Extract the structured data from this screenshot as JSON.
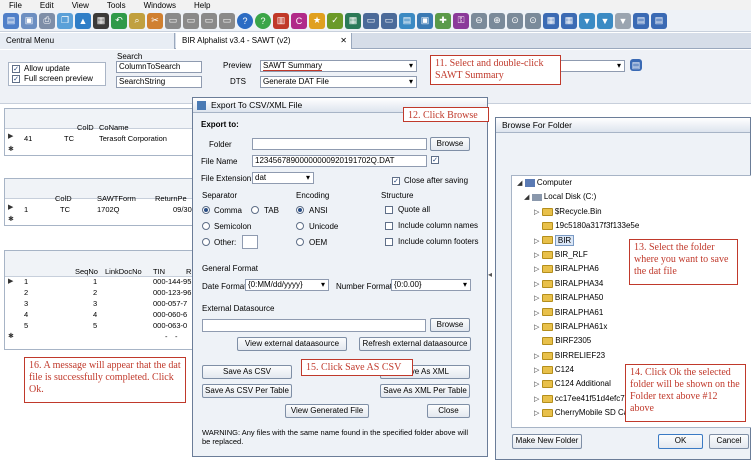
{
  "menu": [
    "File",
    "Edit",
    "View",
    "Tools",
    "Windows",
    "Help"
  ],
  "tabs": [
    "Central Menu",
    "BIR Alphalist v3.4 - SAWT (v2)"
  ],
  "filter": {
    "allow_update": "Allow update",
    "full_screen_preview": "Full screen preview",
    "search_label": "Search",
    "search_col": "ColumnToSearch",
    "search_str": "SearchString",
    "preview_label": "Preview",
    "preview_value": "SAWT Summary",
    "dts_label": "DTS",
    "dts_value": "Generate DAT File"
  },
  "grid1": {
    "headers": [
      "ColD",
      "CoName"
    ],
    "rows": [
      [
        "41",
        "TC",
        "Terasoft Corporation"
      ]
    ]
  },
  "grid2": {
    "headers": [
      "ColD",
      "SAWTForm",
      "ReturnPe"
    ],
    "rows": [
      [
        "1",
        "TC",
        "1702Q",
        "09/30"
      ]
    ]
  },
  "grid3": {
    "headers": [
      "SeqNo",
      "LinkDocNo",
      "TIN",
      "R"
    ],
    "rows": [
      [
        "1",
        "1",
        "000-144-95"
      ],
      [
        "2",
        "2",
        "000-123-96"
      ],
      [
        "3",
        "3",
        "000-057-7"
      ],
      [
        "4",
        "4",
        "000-060-6"
      ],
      [
        "5",
        "5",
        "000-063-0"
      ]
    ],
    "new_row": [
      "-",
      "-"
    ]
  },
  "export": {
    "title": "Export To CSV/XML File",
    "export_to": "Export to:",
    "folder_label": "Folder",
    "browse": "Browse",
    "filename_label": "File Name",
    "filename_value": "12345678900000000920191702Q.DAT",
    "ext_label": "File Extension",
    "ext_value": "dat",
    "close_after": "Close after saving",
    "separator": "Separator",
    "sep_comma": "Comma",
    "sep_tab": "TAB",
    "sep_semicolon": "Semicolon",
    "sep_other": "Other:",
    "encoding": "Encoding",
    "enc_ansi": "ANSI",
    "enc_unicode": "Unicode",
    "enc_oem": "OEM",
    "structure": "Structure",
    "quote_all": "Quote all",
    "include_col_names": "Include column names",
    "include_col_footers": "Include column footers",
    "general_format": "General Format",
    "date_format_label": "Date Format",
    "date_format_value": "{0:MM/dd/yyyy}",
    "number_format_label": "Number Format",
    "number_format_value": "{0:0.00}",
    "ext_ds": "External Datasource",
    "browse2": "Browse",
    "view_ext": "View external dataasource",
    "refresh_ext": "Refresh external dataasource",
    "save_csv": "Save As CSV",
    "save_xml": "Save As XML",
    "save_csv_table": "Save As CSV Per Table",
    "save_xml_table": "Save As XML Per Table",
    "view_generated": "View Generated File",
    "close": "Close",
    "warning": "WARNING: Any files with the same name found in the specified folder above will be replaced."
  },
  "browse_folder": {
    "title": "Browse For Folder",
    "computer": "Computer",
    "local_disk": "Local Disk (C:)",
    "items": [
      "$Recycle.Bin",
      "19c5180a317f3f133e5e",
      "BIR",
      "BIR_RLF",
      "BIRALPHA6",
      "BIRALPHA34",
      "BIRALPHA50",
      "BIRALPHA61",
      "BIRALPHA61x",
      "BIRF2305",
      "BIRRELIEF23",
      "C124",
      "C124 Additional",
      "cc17ee41f51d4efc73",
      "CherryMobile SD Card"
    ],
    "make_new_folder": "Make New Folder",
    "ok": "OK",
    "cancel": "Cancel"
  },
  "callouts": {
    "c11": "11. Select and double-click SAWT Summary",
    "c12": "12. Click Browse",
    "c13": "13. Select the folder where you want to save the dat file",
    "c14": "14. Click Ok the selected folder will be shown on the Folder text above #12 above",
    "c15": "15. Click Save AS CSV",
    "c16": "16. A message will appear that the dat file is successfully completed. Click Ok."
  },
  "colors": {
    "callout": "#c0392b",
    "folder": "#e8c04a",
    "title_bar": "#dde4ee"
  }
}
